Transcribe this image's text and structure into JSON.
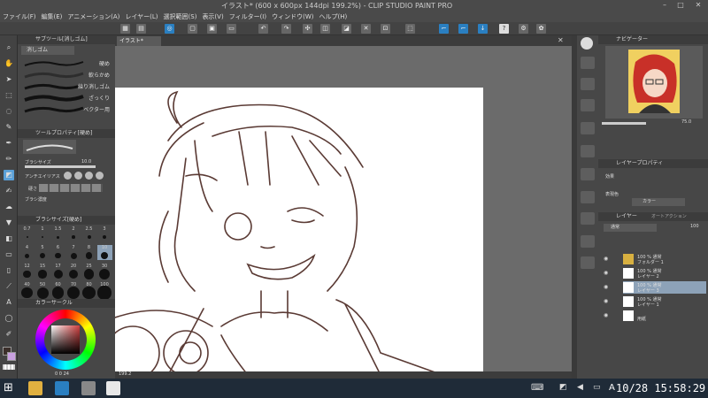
{
  "window": {
    "title": "イラスト* (600 x 600px 144dpi 199.2%) - CLIP STUDIO PAINT PRO",
    "minimize_icon": "minimize-icon",
    "maximize_icon": "maximize-icon",
    "close_icon": "close-icon"
  },
  "menu": {
    "items": [
      "ファイル(F)",
      "編集(E)",
      "アニメーション(A)",
      "レイヤー(L)",
      "選択範囲(S)",
      "表示(V)",
      "フィルター(I)",
      "ウィンドウ(W)",
      "ヘルプ(H)"
    ]
  },
  "canvas": {
    "tab_label": "イラスト*",
    "zoom": "199.2"
  },
  "sub_tool": {
    "panel_title": "サブツール[消しゴム]",
    "group": "消しゴム",
    "brushes": [
      "硬め",
      "軟らかめ",
      "練り消しゴム",
      "ざっくり",
      "ベクター用"
    ]
  },
  "tool_property": {
    "panel_title": "ツールプロパティ[硬め]",
    "brush_size_label": "ブラシサイズ",
    "brush_size_value": "10.0",
    "antialias_label": "アンチエイリアス",
    "hardness_label": "硬さ",
    "density_label": "ブラシ濃度"
  },
  "brush_size_panel": {
    "panel_title": "ブラシサイズ[硬め]",
    "sizes": [
      "0.7",
      "1",
      "1.5",
      "2",
      "2.5",
      "3",
      "4",
      "5",
      "6",
      "7",
      "8",
      "10",
      "12",
      "15",
      "17",
      "20",
      "25",
      "30",
      "40",
      "50",
      "60",
      "70",
      "80",
      "100"
    ]
  },
  "color_panel": {
    "panel_title": "カラーサークル",
    "hsv": [
      "0",
      "0",
      "24"
    ]
  },
  "navigator": {
    "panel_title": "ナビゲーター",
    "zoom_value": "75.0"
  },
  "layer_property": {
    "panel_title": "レイヤープロパティ",
    "effect_label": "効果",
    "expression_color_label": "表現色",
    "expression_color_value": "カラー"
  },
  "layers_panel": {
    "tab_label": "レイヤー",
    "tab2_label": "オートアクション",
    "blend_mode": "通常",
    "opacity": "100",
    "layers": [
      {
        "line1": "100 % 通常",
        "line2": "フォルダー 1",
        "selected": false
      },
      {
        "line1": "100 % 通常",
        "line2": "レイヤー 2",
        "selected": false
      },
      {
        "line1": "100 % 通常",
        "line2": "レイヤー 3",
        "selected": true
      },
      {
        "line1": "100 % 通常",
        "line2": "レイヤー 1",
        "selected": false
      },
      {
        "line1": "",
        "line2": "用紙",
        "selected": false
      }
    ]
  },
  "taskbar": {
    "ime": "A",
    "date": "10/28",
    "time": "15:58:29"
  },
  "colors": {
    "accent": "#2a7fc1",
    "selection": "#8da2b8",
    "panel": "#474747",
    "taskbar": "#1f2b38",
    "sketch_line": "#5a3a34"
  }
}
